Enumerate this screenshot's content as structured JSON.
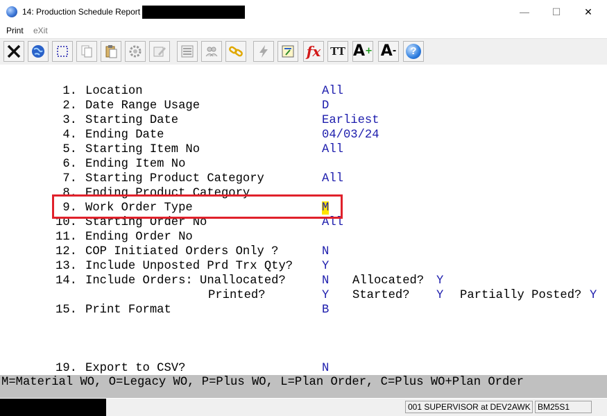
{
  "window": {
    "title": "14: Production Schedule Report -",
    "minimize_glyph": "—",
    "maximize_glyph": "☐",
    "close_glyph": "✕"
  },
  "menu": {
    "print": "Print",
    "exit": "eXit"
  },
  "toolbar": {
    "buttons": [
      "close-x-icon",
      "globe-icon",
      "select-rect-icon",
      "copy-icon",
      "paste-icon",
      "settings-gear-icon",
      "edit-form-icon",
      "list-view-icon",
      "users-icon",
      "link-chain-icon",
      "lightning-icon",
      "calculator-icon",
      "fx-function-icon",
      "font-type-icon",
      "font-increase-icon",
      "font-decrease-icon",
      "help-icon"
    ],
    "fx": "fx",
    "tt": "TT",
    "font_big": "A",
    "font_small": "A",
    "help": "?"
  },
  "form": {
    "fields": [
      {
        "num": " 1.",
        "label": "Location",
        "value": "All"
      },
      {
        "num": " 2.",
        "label": "Date Range Usage",
        "value": "D"
      },
      {
        "num": " 3.",
        "label": "Starting Date",
        "value": "Earliest"
      },
      {
        "num": " 4.",
        "label": "Ending Date",
        "value": "04/03/24"
      },
      {
        "num": " 5.",
        "label": "Starting Item No",
        "value": "All"
      },
      {
        "num": " 6.",
        "label": "Ending Item No",
        "value": ""
      },
      {
        "num": " 7.",
        "label": "Starting Product Category",
        "value": "All"
      },
      {
        "num": " 8.",
        "label": "Ending Product Category",
        "value": ""
      },
      {
        "num": " 9.",
        "label": "Work Order Type",
        "value": "M"
      },
      {
        "num": "10.",
        "label": "Starting Order No",
        "value": "All"
      },
      {
        "num": "11.",
        "label": "Ending Order No",
        "value": ""
      },
      {
        "num": "12.",
        "label": "COP Initiated Orders Only ?",
        "value": "N"
      },
      {
        "num": "13.",
        "label": "Include Unposted Prd Trx Qty?",
        "value": "Y"
      },
      {
        "num": "14.",
        "label": "Include Orders: Unallocated?",
        "value": "N"
      },
      {
        "num": "15.",
        "label": "Print Format",
        "value": "B"
      },
      {
        "num": "19.",
        "label": "Export to CSV?",
        "value": "N"
      }
    ],
    "row14": {
      "allocated_label": "Allocated?",
      "allocated_value": "Y"
    },
    "row14b": {
      "printed_label": "Printed?",
      "printed_value": "Y",
      "started_label": "Started?",
      "started_value": "Y",
      "partial_label": "Partially Posted?",
      "partial_value": "Y"
    }
  },
  "hint": "M=Material WO, O=Legacy WO, P=Plus WO, L=Plan Order, C=Plus WO+Plan Order",
  "status": {
    "user": "001 SUPERVISOR at DEV2AWK",
    "program": "BM25S1"
  },
  "colors": {
    "highlight": "#e0212b",
    "value_text": "#1d1dad",
    "cursor": "#ffe400"
  }
}
